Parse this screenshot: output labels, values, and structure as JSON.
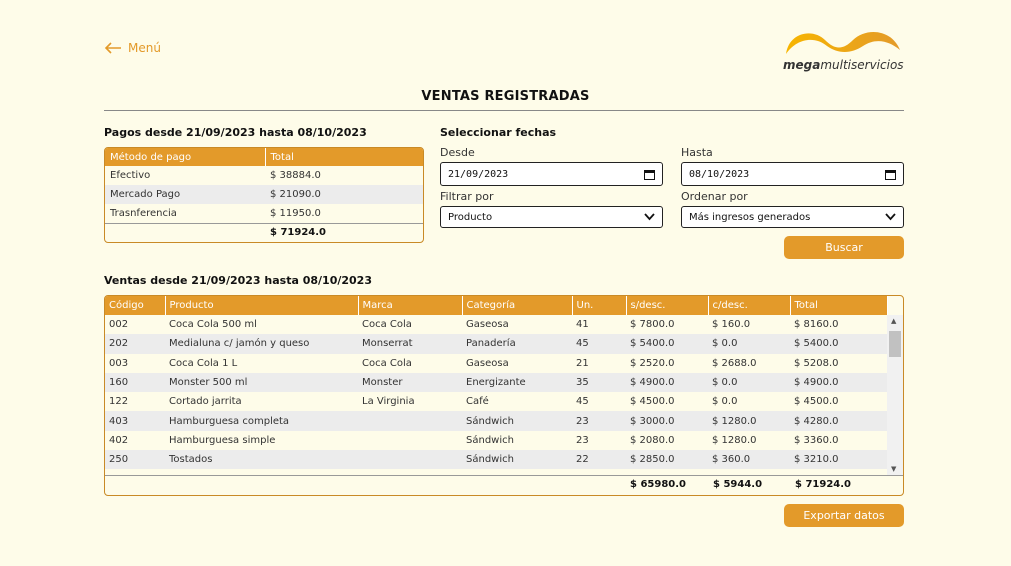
{
  "nav": {
    "menu_label": "Menú"
  },
  "logo": {
    "bold": "mega",
    "rest": "multiservicios"
  },
  "page_title": "VENTAS REGISTRADAS",
  "payments": {
    "title": "Pagos desde 21/09/2023 hasta 08/10/2023",
    "headers": [
      "Método de pago",
      "Total"
    ],
    "rows": [
      [
        "Efectivo",
        "$ 38884.0"
      ],
      [
        "Mercado Pago",
        "$ 21090.0"
      ],
      [
        "Trasnferencia",
        "$ 11950.0"
      ]
    ],
    "total": "$ 71924.0"
  },
  "filters": {
    "title": "Seleccionar fechas",
    "desde_label": "Desde",
    "desde_value": "21/09/2023",
    "hasta_label": "Hasta",
    "hasta_value": "08/10/2023",
    "filtrar_label": "Filtrar por",
    "filtrar_value": "Producto",
    "ordenar_label": "Ordenar por",
    "ordenar_value": "Más ingresos generados",
    "buscar_label": "Buscar"
  },
  "sales": {
    "title": "Ventas desde 21/09/2023 hasta 08/10/2023",
    "headers": [
      "Código",
      "Producto",
      "Marca",
      "Categoría",
      "Un.",
      "s/desc.",
      "c/desc.",
      "Total"
    ],
    "rows": [
      [
        "002",
        "Coca Cola 500 ml",
        "Coca Cola",
        "Gaseosa",
        "41",
        "$ 7800.0",
        "$ 160.0",
        "$ 8160.0"
      ],
      [
        "202",
        "Medialuna c/ jamón y queso",
        "Monserrat",
        "Panadería",
        "45",
        "$ 5400.0",
        "$ 0.0",
        "$ 5400.0"
      ],
      [
        "003",
        "Coca Cola 1 L",
        "Coca Cola",
        "Gaseosa",
        "21",
        "$ 2520.0",
        "$ 2688.0",
        "$ 5208.0"
      ],
      [
        "160",
        "Monster 500 ml",
        "Monster",
        "Energizante",
        "35",
        "$ 4900.0",
        "$ 0.0",
        "$ 4900.0"
      ],
      [
        "122",
        "Cortado jarrita",
        "La Virginia",
        "Café",
        "45",
        "$ 4500.0",
        "$ 0.0",
        "$ 4500.0"
      ],
      [
        "403",
        "Hamburguesa completa",
        "",
        "Sándwich",
        "23",
        "$ 3000.0",
        "$ 1280.0",
        "$ 4280.0"
      ],
      [
        "402",
        "Hamburguesa simple",
        "",
        "Sándwich",
        "23",
        "$ 2080.0",
        "$ 1280.0",
        "$ 3360.0"
      ],
      [
        "250",
        "Tostados",
        "",
        "Sándwich",
        "22",
        "$ 2850.0",
        "$ 360.0",
        "$ 3210.0"
      ]
    ],
    "totals": {
      "sdesc": "$ 65980.0",
      "cdesc": "$ 5944.0",
      "total": "$ 71924.0"
    }
  },
  "export_label": "Exportar datos",
  "colors": {
    "accent": "#e39a2a",
    "background": "#fefce9"
  }
}
